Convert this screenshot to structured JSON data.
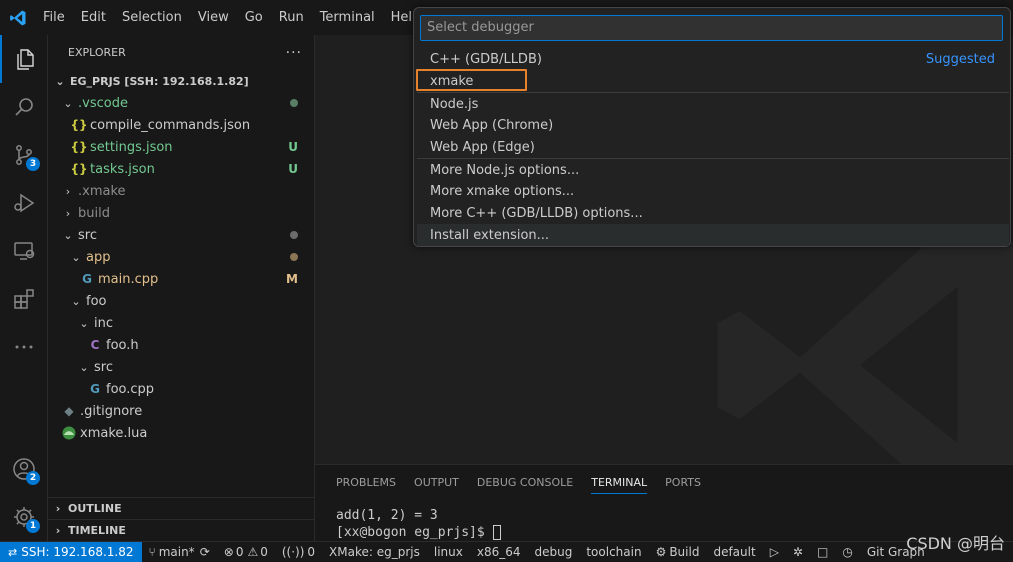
{
  "menu": [
    "File",
    "Edit",
    "Selection",
    "View",
    "Go",
    "Run",
    "Terminal",
    "Help"
  ],
  "activity": {
    "source_control_badge": "3",
    "accounts_badge": "2",
    "manage_badge": "1"
  },
  "explorer": {
    "title": "EXPLORER",
    "more": "···",
    "root": "EG_PRJS [SSH: 192.168.1.82]",
    "items": [
      {
        "label": ".vscode",
        "status": ""
      },
      {
        "label": "compile_commands.json",
        "status": ""
      },
      {
        "label": "settings.json",
        "status": "U"
      },
      {
        "label": "tasks.json",
        "status": "U"
      },
      {
        "label": ".xmake",
        "status": ""
      },
      {
        "label": "build",
        "status": ""
      },
      {
        "label": "src",
        "status": ""
      },
      {
        "label": "app",
        "status": ""
      },
      {
        "label": "main.cpp",
        "status": "M"
      },
      {
        "label": "foo",
        "status": ""
      },
      {
        "label": "inc",
        "status": ""
      },
      {
        "label": "foo.h",
        "status": ""
      },
      {
        "label": "src",
        "status": ""
      },
      {
        "label": "foo.cpp",
        "status": ""
      },
      {
        "label": ".gitignore",
        "status": ""
      },
      {
        "label": "xmake.lua",
        "status": ""
      }
    ],
    "json_icon": "{}",
    "c_icon": "C",
    "cpp_icon": "G",
    "outline": "OUTLINE",
    "timeline": "TIMELINE"
  },
  "quickpick": {
    "placeholder": "Select debugger",
    "items": [
      {
        "label": "C++ (GDB/LLDB)",
        "right": "Suggested"
      },
      {
        "label": "xmake",
        "right": ""
      },
      {
        "label": "Node.js",
        "right": ""
      },
      {
        "label": "Web App (Chrome)",
        "right": ""
      },
      {
        "label": "Web App (Edge)",
        "right": ""
      },
      {
        "label": "More Node.js options...",
        "right": ""
      },
      {
        "label": "More xmake options...",
        "right": ""
      },
      {
        "label": "More C++ (GDB/LLDB) options...",
        "right": ""
      },
      {
        "label": "Install extension...",
        "right": ""
      }
    ]
  },
  "panel": {
    "tabs": [
      "PROBLEMS",
      "OUTPUT",
      "DEBUG CONSOLE",
      "TERMINAL",
      "PORTS"
    ],
    "active_tab": "TERMINAL",
    "terminal_lines": [
      "add(1, 2) = 3",
      "[xx@bogon eg_prjs]$ "
    ]
  },
  "status": {
    "remote": "SSH: 192.168.1.82",
    "branch": "main*",
    "errors": "0",
    "warnings": "0",
    "ports": "0",
    "xmake_project": "XMake: eg_prjs",
    "platform": "linux",
    "arch": "x86_64",
    "mode": "debug",
    "toolchain": "toolchain",
    "build": "Build",
    "target": "default",
    "git_graph": "Git Graph"
  },
  "watermark": "CSDN @明台",
  "colors": {
    "accent": "#0078d4",
    "git_untracked": "#73c991",
    "git_modified": "#e2c08d",
    "highlight": "#e7812b"
  }
}
